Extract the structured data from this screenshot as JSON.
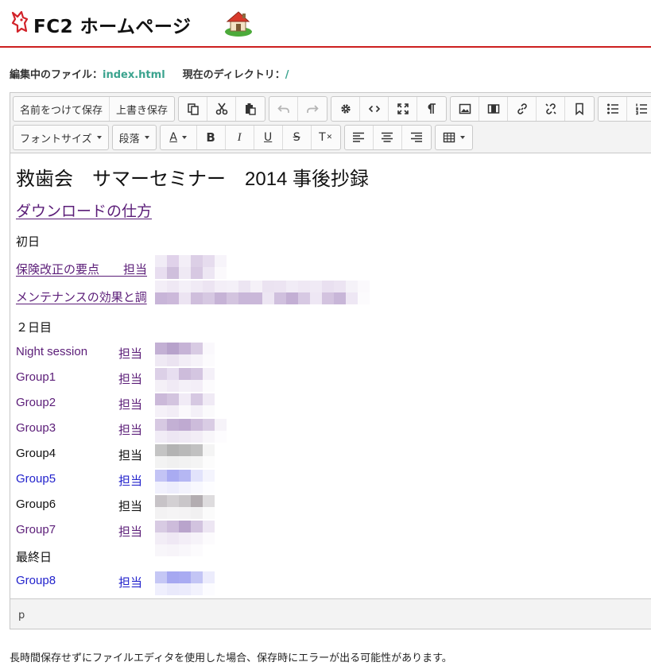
{
  "header": {
    "logo_text": "FC2 ホームページ",
    "logo_icon": "fc2-horse-icon",
    "house_icon": "house-icon"
  },
  "fileinfo": {
    "file_label": "編集中のファイル：",
    "file_name": "index.html",
    "dir_label": "現在のディレクトリ：",
    "dir_value": "/"
  },
  "toolbar": {
    "save_as_label": "名前をつけて保存",
    "overwrite_label": "上書き保存",
    "font_size_label": "フォントサイズ",
    "paragraph_label": "段落",
    "font_color_label": "A",
    "bold_label": "B",
    "italic_label": "I",
    "underline_label": "U",
    "strike_label": "S",
    "clear_label": "T",
    "icons": [
      "copy-icon",
      "cut-icon",
      "paste-icon",
      "undo-icon",
      "redo-icon",
      "gear-icon",
      "code-icon",
      "fullscreen-icon",
      "pilcrow-icon",
      "image-icon",
      "video-icon",
      "link-icon",
      "unlink-icon",
      "bookmark-icon",
      "bullet-list-icon",
      "numbered-list-icon",
      "align-left-icon",
      "align-center-icon",
      "align-right-icon",
      "table-icon"
    ]
  },
  "content": {
    "title": "救歯会　サマーセミナー　2014 事後抄録",
    "download_link": "ダウンロードの仕方",
    "day1_label": "初日",
    "day1_items": [
      {
        "name": "保険改正の要点　　担当"
      },
      {
        "name": "メンテナンスの効果と調"
      }
    ],
    "day2_label": "２日目",
    "day2_items": [
      {
        "name": "Night session",
        "resp": "担当",
        "style": "link"
      },
      {
        "name": "Group1",
        "resp": "担当",
        "style": "link"
      },
      {
        "name": "Group2",
        "resp": "担当",
        "style": "link"
      },
      {
        "name": "Group3",
        "resp": "担当",
        "style": "link"
      },
      {
        "name": "Group4",
        "resp": "担当",
        "style": "plain"
      },
      {
        "name": "Group5",
        "resp": "担当",
        "style": "blue"
      },
      {
        "name": "Group6",
        "resp": "担当",
        "style": "plain"
      },
      {
        "name": "Group7",
        "resp": "担当",
        "style": "link"
      }
    ],
    "last_day_label": "最終日",
    "last_day_items": [
      {
        "name": "Group8",
        "resp": "担当",
        "style": "blue"
      }
    ]
  },
  "statusbar": {
    "path": "p"
  },
  "note": "長時間保存せずにファイルエディタを使用した場合、保存時にエラーが出る可能性があります。",
  "colors": {
    "header_rule": "#cc1f1f",
    "fileinfo_value": "#3aa38e",
    "visited_link": "#5b1d78",
    "link": "#2222cc"
  }
}
